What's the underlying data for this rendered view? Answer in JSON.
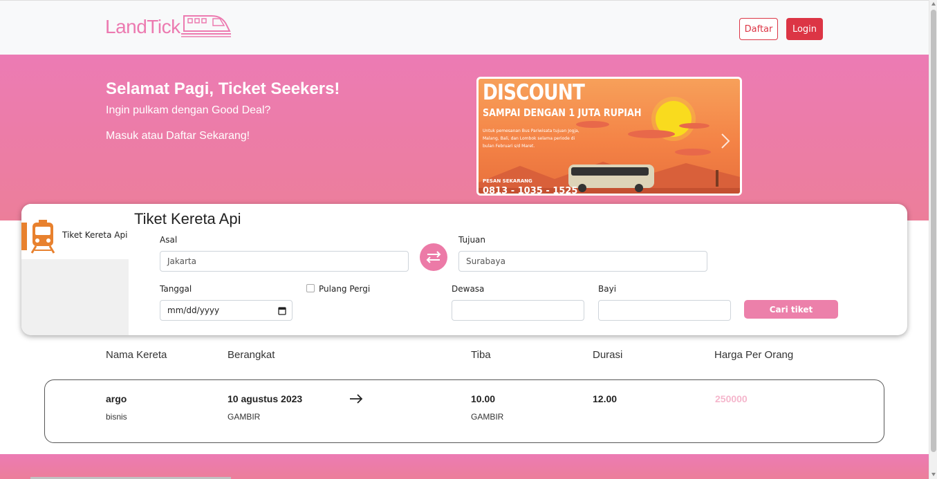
{
  "brand": {
    "logo_text": "LandTick",
    "accent": "#ec7ab0"
  },
  "navbar": {
    "daftar_label": "Daftar",
    "login_label": "Login",
    "danger": "#dc3545"
  },
  "hero": {
    "title": "Selamat Pagi, Ticket Seekers!",
    "subtitle": "Ingin pulkam dengan Good Deal?",
    "cta_text": "Masuk atau Daftar Sekarang!"
  },
  "banner": {
    "headline": "DISCOUNT",
    "subheadline": "SAMPAI DENGAN 1 JUTA RUPIAH",
    "description": "Untuk pemesanan Bus Pariwisata tujuan Jogja, Malang, Bali, dan Lombok selama periode di bulan Februari s/d Maret.",
    "order_label": "PESAN SEKARANG",
    "phone": "0813 - 1035 - 1525",
    "next_icon": "chevron-right-icon"
  },
  "sidebar": {
    "active_tab_label": "Tiket Kereta Api",
    "tab_icon": "train-icon",
    "tab_color": "#e8812e"
  },
  "form": {
    "title": "Tiket Kereta Api",
    "asal_label": "Asal",
    "asal_value": "Jakarta",
    "tujuan_label": "Tujuan",
    "tujuan_value": "Surabaya",
    "tanggal_label": "Tanggal",
    "tanggal_placeholder": "mm/dd/yyyy",
    "pulang_pergi_label": "Pulang Pergi",
    "dewasa_label": "Dewasa",
    "dewasa_value": "",
    "bayi_label": "Bayi",
    "bayi_value": "",
    "search_label": "Cari tiket",
    "swap_icon": "swap-arrows-icon"
  },
  "table": {
    "headers": [
      "Nama Kereta",
      "Berangkat",
      "Tiba",
      "Durasi",
      "Harga Per Orang"
    ],
    "rows": [
      {
        "train_name": "argo",
        "train_class": "bisnis",
        "depart_date": "10 agustus 2023",
        "depart_station": "GAMBIR",
        "arrive_time": "10.00",
        "arrive_station": "GAMBIR",
        "duration": "12.00",
        "price": "250000"
      }
    ]
  }
}
